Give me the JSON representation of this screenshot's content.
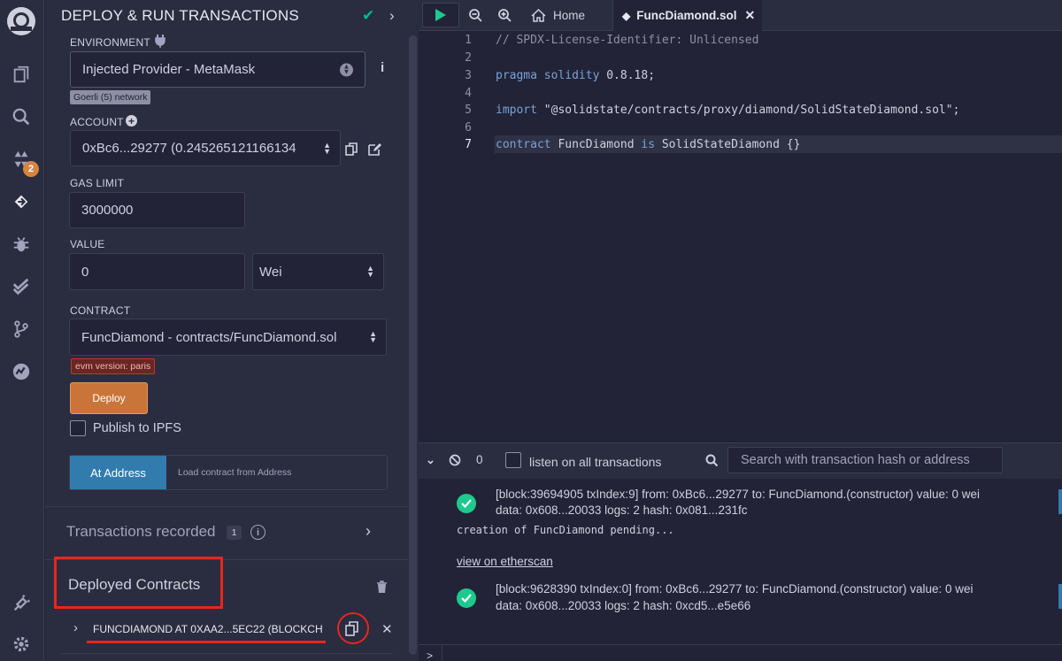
{
  "panel": {
    "title": "DEPLOY & RUN TRANSACTIONS",
    "environment_label": "ENVIRONMENT",
    "environment_value": "Injected Provider - MetaMask",
    "network_badge": "Goerli (5) network",
    "account_label": "ACCOUNT",
    "account_value": "0xBc6...29277 (0.245265121166134",
    "gas_limit_label": "GAS LIMIT",
    "gas_limit_value": "3000000",
    "value_label": "VALUE",
    "value_amount": "0",
    "value_unit": "Wei",
    "contract_label": "CONTRACT",
    "contract_value": "FuncDiamond - contracts/FuncDiamond.sol",
    "evm_badge": "evm version: paris",
    "deploy_label": "Deploy",
    "publish_label": "Publish to IPFS",
    "at_address_label": "At Address",
    "at_address_placeholder": "Load contract from Address",
    "transactions_recorded_label": "Transactions recorded",
    "transactions_recorded_count": "1",
    "deployed_contracts_label": "Deployed Contracts",
    "deployed_contract_item": "FUNCDIAMOND AT 0XAA2...5EC22 (BLOCKCH"
  },
  "iconbar": {
    "badge_count": "2",
    "icons": [
      "remix-logo-icon",
      "file-explorer-icon",
      "search-icon",
      "solidity-compiler-icon",
      "deploy-run-icon",
      "debugger-icon",
      "testing-icon",
      "git-icon",
      "analytics-icon",
      "plugin-manager-icon",
      "settings-icon"
    ]
  },
  "tabs": {
    "home": "Home",
    "file": "FuncDiamond.sol"
  },
  "editor": {
    "line_numbers": [
      "1",
      "2",
      "3",
      "4",
      "5",
      "6",
      "7"
    ],
    "current_line": "7",
    "line1": "// SPDX-License-Identifier: Unlicensed",
    "line3_kw": "pragma solidity",
    "line3_rest": " 0.8.18;",
    "line5_kw": "import",
    "line5_rest": " \"@solidstate/contracts/proxy/diamond/SolidStateDiamond.sol\";",
    "line7_kw1": "contract",
    "line7_mid": " FuncDiamond ",
    "line7_kw2": "is",
    "line7_rest": " SolidStateDiamond {}"
  },
  "terminal": {
    "pending_count": "0",
    "listen_label": "listen on all transactions",
    "search_placeholder": "Search with transaction hash or address",
    "tx1_line1": "[block:39694905 txIndex:9]  from: 0xBc6...29277 to: FuncDiamond.(constructor) value: 0 wei",
    "tx1_line2": "data: 0x608...20033 logs: 2 hash: 0x081...231fc",
    "pending_text": "creation of FuncDiamond pending...",
    "etherscan_link": "view on etherscan",
    "tx2_line1": "[block:9628390 txIndex:0]  from: 0xBc6...29277 to: FuncDiamond.(constructor) value: 0 wei",
    "tx2_line2": "data: 0x608...20033 logs: 2 hash: 0xcd5...e5e66",
    "prompt": ">"
  },
  "colors": {
    "accent_blue": "#317bad",
    "deploy_orange": "#c97539",
    "success_green": "#1ec98e",
    "highlight_red": "#e8261d"
  }
}
